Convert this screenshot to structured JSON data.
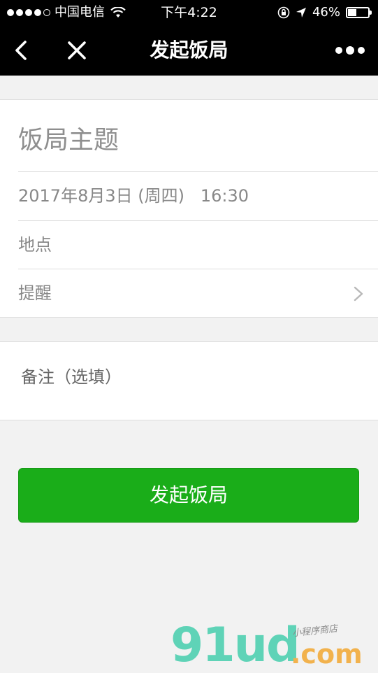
{
  "status_bar": {
    "carrier": "中国电信",
    "time": "下午4:22",
    "battery": "46%",
    "battery_level": 0.46,
    "signal_icon": "signal-dots-icon",
    "wifi_icon": "wifi-icon",
    "lock_icon": "orientation-lock-icon",
    "location_icon": "location-arrow-icon"
  },
  "nav": {
    "title": "发起饭局",
    "back_icon": "chevron-left-icon",
    "close_icon": "close-icon",
    "more_icon": "more-dots-icon"
  },
  "form": {
    "topic_placeholder": "饭局主题",
    "datetime": "2017年8月3日 (周四)   16:30",
    "location_placeholder": "地点",
    "reminder_label": "提醒",
    "note_placeholder": "备注（选填）"
  },
  "actions": {
    "submit_label": "发起饭局"
  },
  "watermark": {
    "logo": "91ud",
    "domain": ".com",
    "tagline": "小程序商店"
  },
  "colors": {
    "primary": "#1aad19",
    "nav_background": "#000000",
    "page_background": "#f2f2f2"
  }
}
